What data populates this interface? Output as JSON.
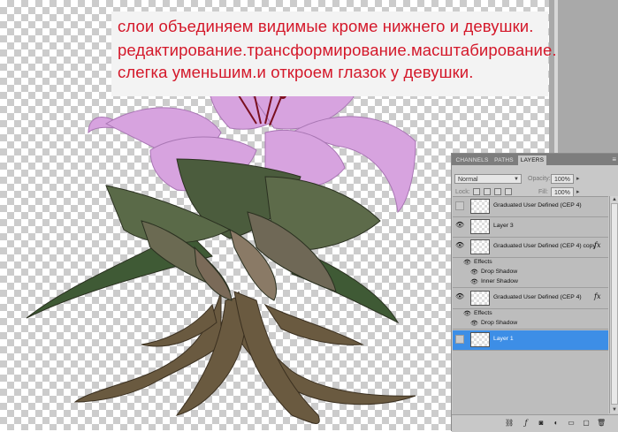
{
  "instructions": {
    "line1": "слои объединяем видимые кроме нижнего и девушки.",
    "line2": "редактирование.трансформирование.масштабирование.",
    "line3": "слегка уменьшим.и откроем глазок у девушки."
  },
  "panel": {
    "tabs": [
      "CHANNELS",
      "PATHS",
      "LAYERS"
    ],
    "active_tab": "LAYERS",
    "blend_mode": "Normal",
    "opacity_label": "Opacity:",
    "opacity_value": "100%",
    "lock_label": "Lock:",
    "fill_label": "Fill:",
    "fill_value": "100%",
    "layers": [
      {
        "name": "Graduated User Defined (CEP 4)",
        "visible": false,
        "fx": false
      },
      {
        "name": "Layer 3",
        "visible": true,
        "fx": false
      },
      {
        "name": "Graduated User Defined (CEP 4) copy",
        "visible": true,
        "fx": true,
        "effects_label": "Effects",
        "effects": [
          "Drop Shadow",
          "Inner Shadow"
        ]
      },
      {
        "name": "Graduated User Defined (CEP 4)",
        "visible": true,
        "fx": true,
        "effects_label": "Effects",
        "effects": [
          "Drop Shadow"
        ]
      },
      {
        "name": "Layer 1",
        "visible": false,
        "fx": false,
        "selected": true
      }
    ],
    "fx_symbol": "fx",
    "selection_color": "#3d8ee6"
  },
  "colors": {
    "text_red": "#d4182a",
    "lily": "#d9a8e0"
  }
}
